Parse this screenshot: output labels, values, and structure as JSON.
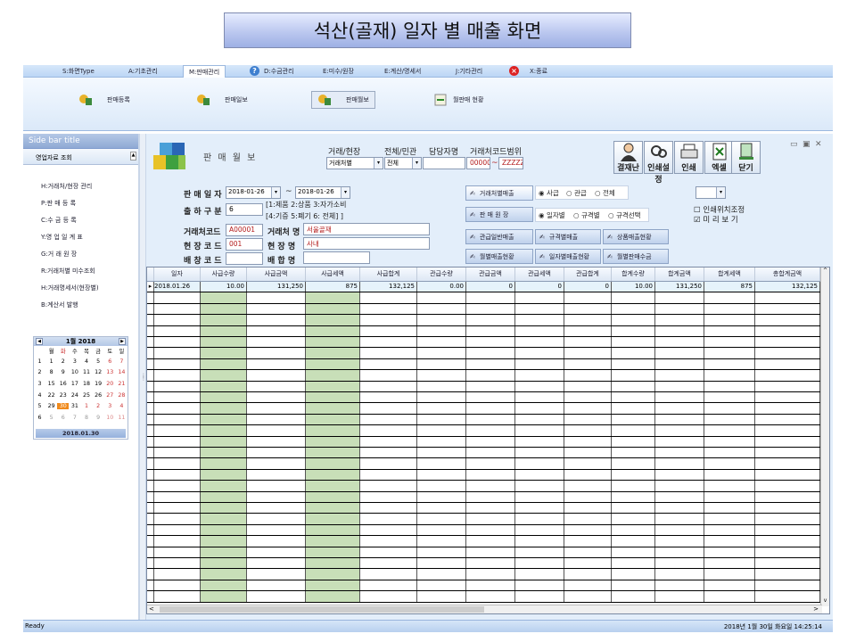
{
  "title": "석산(골재) 일자 별 매출  화면",
  "menu": {
    "items": [
      "S:화면Type",
      "A:기초관리",
      "M:판매관리",
      "D:수금관리",
      "E:미수/원장",
      "E:계산/명세서",
      "J:기타관리",
      "X:종료"
    ]
  },
  "ribbon": {
    "items": [
      "판매등록",
      "판매일보",
      "판매월보",
      "월판매 현황"
    ]
  },
  "sidebar": {
    "title": "Side bar title",
    "section": "영업자료 조회",
    "items": [
      "H:거래처/현장 관리",
      "P:판 매 등 록",
      "C:수 금 등 록",
      "Y:영 업 일 계 표",
      "G:거 래 원 장",
      "R:거래처별 미수조회",
      "H:거래명세서(현장별)",
      "B:계산서 발행"
    ]
  },
  "calendar": {
    "month": "1월 2018",
    "weekdays": [
      "월",
      "화",
      "수",
      "목",
      "금",
      "토",
      "일"
    ],
    "weeks": [
      [
        "1",
        "1",
        "2",
        "3",
        "4",
        "5",
        "6",
        "7"
      ],
      [
        "2",
        "8",
        "9",
        "10",
        "11",
        "12",
        "13",
        "14"
      ],
      [
        "3",
        "15",
        "16",
        "17",
        "18",
        "19",
        "20",
        "21"
      ],
      [
        "4",
        "22",
        "23",
        "24",
        "25",
        "26",
        "27",
        "28"
      ],
      [
        "5",
        "29",
        "30",
        "31",
        "1",
        "2",
        "3",
        "4"
      ],
      [
        "6",
        "5",
        "6",
        "7",
        "8",
        "9",
        "10",
        "11"
      ]
    ],
    "today": "2018.01.30"
  },
  "form": {
    "title": "판 매 월 보",
    "header_labels": {
      "trade": "거래/현장",
      "all": "전체/민관",
      "manager": "담당자명",
      "range": "거래처코드범위"
    },
    "trade_combo": "거래처별",
    "all_combo": "전체",
    "range_from": "000000",
    "range_sep": "~",
    "range_to": "ZZZZZ",
    "date_label": "판 매 일 자",
    "date_from": "2018-01-26",
    "date_sep": "~",
    "date_to": "2018-01-26",
    "ship_label": "출 하 구 분",
    "ship_value": "6",
    "ship_hint1": "[1:제품 2:상품 3:자가소비",
    "ship_hint2": "[4:기증 5:폐기 6: 전체] ]",
    "client_code_label": "거래처코드",
    "client_code": "A00001",
    "client_name_label": "거래처 명",
    "client_name": "서울골재",
    "site_code_label": "현 장 코 드",
    "site_code": "001",
    "site_name_label": "현 장 명",
    "site_name": "사내",
    "plant_code_label": "배 창 코 드",
    "plant_name_label": "배 합 명"
  },
  "buttons": {
    "b1": "거래처별매출",
    "b2": "판 매 원 장",
    "b3": "관급일반매출",
    "b4": "규격별매출",
    "b5": "상품매출현황",
    "b6": "월별매출현황",
    "b7": "일자별매출현황",
    "b8": "월별판매수금"
  },
  "radios": {
    "r1": [
      "사급",
      "관급",
      "전체"
    ],
    "r2": [
      "일자별",
      "규격별",
      "규격선택"
    ]
  },
  "options": {
    "print_pos": "인쇄위치조정",
    "preview": "미 리 보 기"
  },
  "toolbar": [
    "결재난",
    "인쇄설정",
    "인쇄",
    "엑셀",
    "닫기"
  ],
  "grid": {
    "columns": [
      "일자",
      "사급수량",
      "사급금액",
      "사급세액",
      "사급합계",
      "관급수량",
      "관급금액",
      "관급세액",
      "관급합계",
      "합계수량",
      "합계금액",
      "합계세액",
      "총합계금액"
    ],
    "rows": [
      [
        "2018.01.26",
        "10.00",
        "131,250",
        "875",
        "132,125",
        "0.00",
        "0",
        "0",
        "0",
        "10.00",
        "131,250",
        "875",
        "132,125"
      ]
    ]
  },
  "status": {
    "left": "Ready",
    "right": "2018년 1월 30일 화요일 14:25:14"
  }
}
